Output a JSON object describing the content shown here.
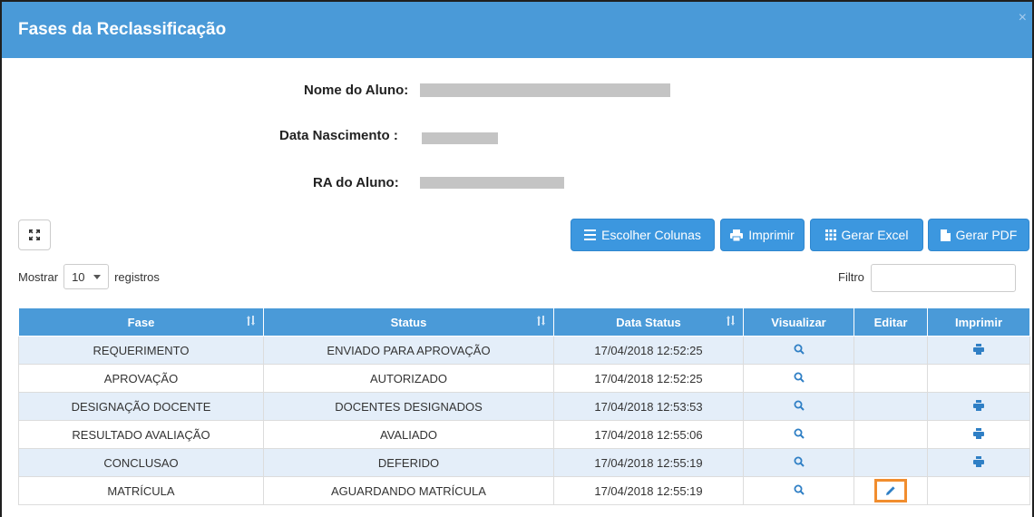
{
  "modal": {
    "title": "Fases da Reclassificação",
    "close_label": "×"
  },
  "student_info": {
    "name_label": "Nome do Aluno:",
    "birth_label": "Data Nascimento :",
    "ra_label": "RA do Aluno:"
  },
  "toolbar": {
    "expand_icon": "expand-icon",
    "choose_columns_label": "Escolher Colunas",
    "print_label": "Imprimir",
    "excel_label": "Gerar Excel",
    "pdf_label": "Gerar PDF"
  },
  "length_menu": {
    "show_label": "Mostrar",
    "value": "10",
    "records_label": "registros"
  },
  "filter": {
    "label": "Filtro",
    "value": ""
  },
  "table": {
    "headers": {
      "fase": "Fase",
      "status": "Status",
      "data_status": "Data Status",
      "visualizar": "Visualizar",
      "editar": "Editar",
      "imprimir": "Imprimir"
    },
    "rows": [
      {
        "fase": "REQUERIMENTO",
        "status": "ENVIADO PARA APROVAÇÃO",
        "data_status": "17/04/2018 12:52:25"
      },
      {
        "fase": "APROVAÇÃO",
        "status": "AUTORIZADO",
        "data_status": "17/04/2018 12:52:25"
      },
      {
        "fase": "DESIGNAÇÃO DOCENTE",
        "status": "DOCENTES DESIGNADOS",
        "data_status": "17/04/2018 12:53:53"
      },
      {
        "fase": "RESULTADO AVALIAÇÃO",
        "status": "AVALIADO",
        "data_status": "17/04/2018 12:55:06"
      },
      {
        "fase": "CONCLUSAO",
        "status": "DEFERIDO",
        "data_status": "17/04/2018 12:55:19"
      },
      {
        "fase": "MATRÍCULA",
        "status": "AGUARDANDO MATRÍCULA",
        "data_status": "17/04/2018 12:55:19"
      }
    ]
  },
  "colors": {
    "header_blue": "#4a9ad8",
    "button_blue": "#3c97df",
    "row_stripe": "#e4eef9",
    "highlight": "#f18d2e",
    "icon_blue": "#2f7fc5"
  }
}
